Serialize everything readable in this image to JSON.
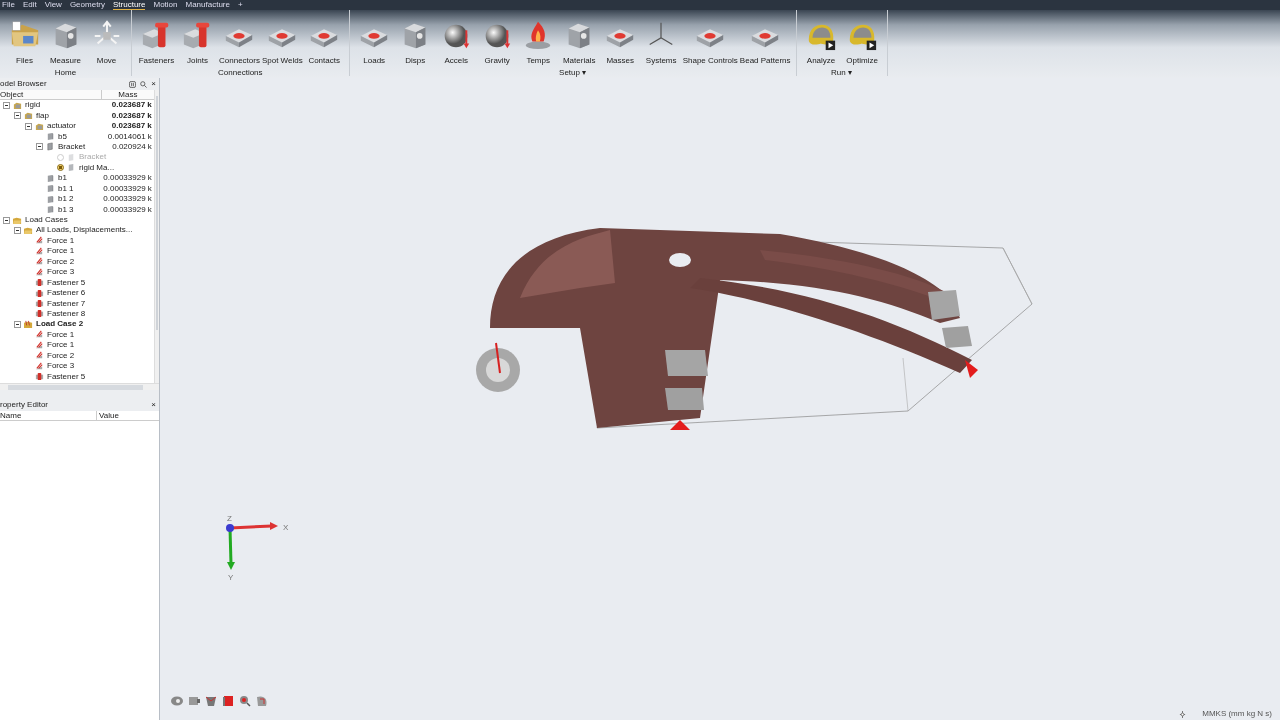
{
  "menu": [
    {
      "label": "File",
      "selected": false
    },
    {
      "label": "Edit",
      "selected": false
    },
    {
      "label": "View",
      "selected": false
    },
    {
      "label": "Geometry",
      "selected": false
    },
    {
      "label": "Structure",
      "selected": true
    },
    {
      "label": "Motion",
      "selected": false
    },
    {
      "label": "Manufacture",
      "selected": false
    }
  ],
  "menu_add": "+",
  "ribbon": [
    {
      "label": "Home",
      "tools": [
        {
          "label": "Files",
          "kind": "folder"
        },
        {
          "label": "Measure",
          "kind": "block"
        },
        {
          "label": "Move",
          "kind": "arrows"
        }
      ]
    },
    {
      "label": "Connections",
      "tools": [
        {
          "label": "Fasteners",
          "kind": "bolt"
        },
        {
          "label": "Joints",
          "kind": "bolt"
        },
        {
          "label": "Connectors",
          "kind": "plate"
        },
        {
          "label": "Spot Welds",
          "kind": "plate"
        },
        {
          "label": "Contacts",
          "kind": "plate"
        }
      ]
    },
    {
      "label": "Setup",
      "caret": "▾",
      "tools": [
        {
          "label": "Loads",
          "kind": "plate"
        },
        {
          "label": "Disps",
          "kind": "block"
        },
        {
          "label": "Accels",
          "kind": "sphere"
        },
        {
          "label": "Gravity",
          "kind": "sphere"
        },
        {
          "label": "Temps",
          "kind": "flame"
        },
        {
          "label": "Materials",
          "kind": "block"
        },
        {
          "label": "Masses",
          "kind": "plate"
        },
        {
          "label": "Systems",
          "kind": "axes"
        },
        {
          "label": "Shape Controls",
          "kind": "plate"
        },
        {
          "label": "Bead Patterns",
          "kind": "plate"
        }
      ]
    },
    {
      "label": "Run",
      "caret": "▾",
      "tools": [
        {
          "label": "Analyze",
          "kind": "blob"
        },
        {
          "label": "Optimize",
          "kind": "blob"
        }
      ]
    }
  ],
  "model_browser": {
    "title": "odel Browser",
    "close": "×",
    "columns": [
      "Object",
      "Mass"
    ],
    "tree": [
      {
        "label": "rigid",
        "kind": "assembly",
        "mass": "0.023687 k",
        "expanded": true,
        "children": [
          {
            "label": "flap",
            "kind": "assembly",
            "mass": "0.023687 k",
            "expanded": true,
            "children": [
              {
                "label": "actuator",
                "kind": "assembly",
                "mass": "0.023687 k",
                "expanded": true,
                "children": [
                  {
                    "label": "b5",
                    "kind": "part",
                    "mass": "0.0014061 k"
                  },
                  {
                    "label": "Bracket",
                    "kind": "variant",
                    "mass": "0.020924 k",
                    "expanded": true,
                    "children": [
                      {
                        "label": "Bracket",
                        "kind": "option",
                        "selected": false,
                        "disabled": true
                      },
                      {
                        "label": "rigid Ma...",
                        "kind": "option",
                        "selected": true,
                        "disabled": false
                      }
                    ]
                  },
                  {
                    "label": "b1",
                    "kind": "part",
                    "mass": "0.00033929 k"
                  },
                  {
                    "label": "b1 1",
                    "kind": "part",
                    "mass": "0.00033929 k"
                  },
                  {
                    "label": "b1 2",
                    "kind": "part",
                    "mass": "0.00033929 k"
                  },
                  {
                    "label": "b1 3",
                    "kind": "part",
                    "mass": "0.00033929 k"
                  }
                ]
              }
            ]
          }
        ]
      },
      {
        "label": "Load Cases",
        "kind": "folder",
        "expanded": true,
        "children": [
          {
            "label": "All Loads, Displacements...",
            "kind": "folder",
            "expanded": true,
            "children": [
              {
                "label": "Force 1",
                "kind": "force"
              },
              {
                "label": "Force 1",
                "kind": "force"
              },
              {
                "label": "Force 2",
                "kind": "force"
              },
              {
                "label": "Force 3",
                "kind": "force"
              },
              {
                "label": "Fastener 5",
                "kind": "fastener"
              },
              {
                "label": "Fastener 6",
                "kind": "fastener"
              },
              {
                "label": "Fastener 7",
                "kind": "fastener"
              },
              {
                "label": "Fastener 8",
                "kind": "fastener"
              }
            ]
          },
          {
            "label": "Load Case 2",
            "kind": "loadcase",
            "bold": true,
            "expanded": true,
            "children": [
              {
                "label": "Force 1",
                "kind": "force"
              },
              {
                "label": "Force 1",
                "kind": "force"
              },
              {
                "label": "Force 2",
                "kind": "force"
              },
              {
                "label": "Force 3",
                "kind": "force"
              },
              {
                "label": "Fastener 5",
                "kind": "fastener"
              }
            ]
          }
        ]
      }
    ]
  },
  "property_editor": {
    "title": "roperty Editor",
    "close": "×",
    "columns": [
      "Name",
      "Value"
    ]
  },
  "triad": {
    "z": "Z",
    "x": "X",
    "y": "Y"
  },
  "status": {
    "units": "MMKS (mm kg N s)"
  }
}
